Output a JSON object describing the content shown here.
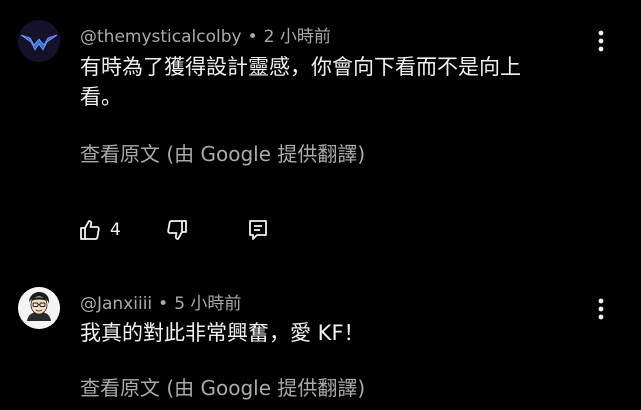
{
  "comments": [
    {
      "author": "@themysticalcolby",
      "time": "2 小時前",
      "separator": "•",
      "text_line1": "有時為了獲得設計靈感，你會向下看而不是向上",
      "text_line2": "看。",
      "translate_label": "查看原文 (由 Google 提供翻譯)",
      "like_count": "4",
      "avatar_icon": "nightwing-logo-icon"
    },
    {
      "author": "@Janxiiii",
      "time": "5 小時前",
      "separator": "•",
      "text_line1": "我真的對此非常興奮，愛 KF！",
      "translate_label": "查看原文 (由 Google 提供翻譯)",
      "avatar_icon": "cartoon-person-avatar"
    }
  ],
  "colors": {
    "background": "#000000",
    "primary_text": "#f1f1f1",
    "secondary_text": "#aaaaaa"
  }
}
